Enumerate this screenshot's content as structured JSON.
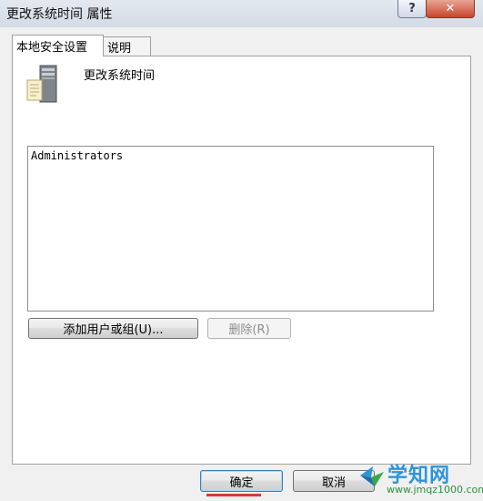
{
  "window": {
    "title": "更改系统时间 属性",
    "help_label": "?",
    "close_label": "✕"
  },
  "tabs": [
    {
      "label": "本地安全设置",
      "active": true
    },
    {
      "label": "说明",
      "active": false
    }
  ],
  "policy": {
    "name": "更改系统时间",
    "icon": "server-icon"
  },
  "members": {
    "items": [
      "Administrators"
    ]
  },
  "buttons": {
    "add": "添加用户或组(U)...",
    "remove": "删除(R)",
    "ok": "确定",
    "cancel": "取消"
  },
  "watermark": {
    "title": "学知网",
    "url": "www.jmqz1000.com"
  }
}
